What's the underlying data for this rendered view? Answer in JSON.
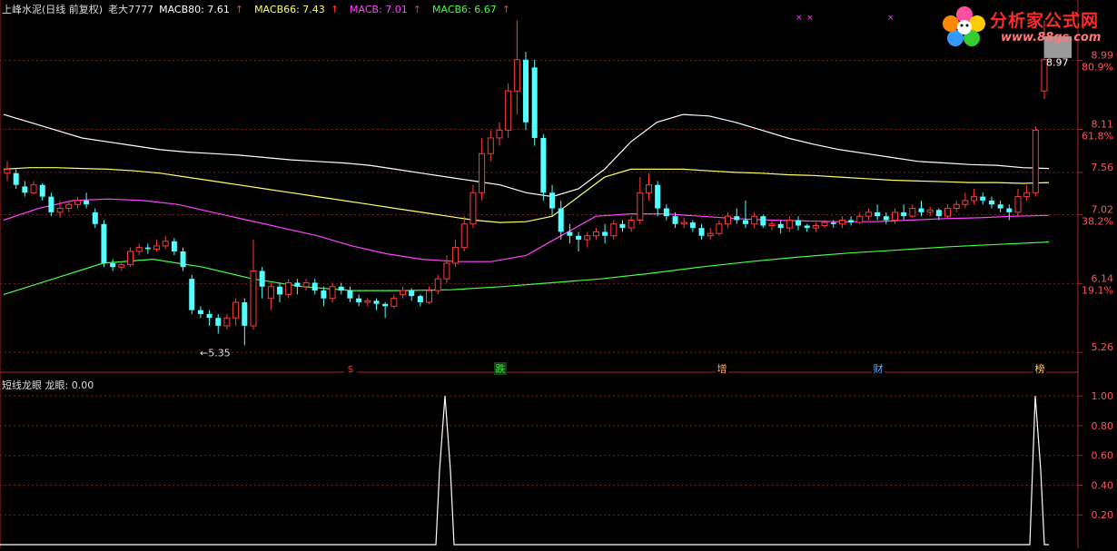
{
  "header": {
    "stock": "上峰水泥(日线 前复权)",
    "author": "老大7777",
    "indicators": [
      {
        "label": "MACB80: 7.61",
        "color": "#ffffff",
        "arrow": "↑"
      },
      {
        "label": "MACB66: 7.43",
        "color": "#ffff66",
        "arrow": "↑"
      },
      {
        "label": "MACB: 7.01",
        "color": "#ff44ff",
        "arrow": "↑"
      },
      {
        "label": "MACB6: 6.67",
        "color": "#44ff44",
        "arrow": "↑"
      }
    ]
  },
  "sub_header": {
    "title": "短线龙眼",
    "value_label": "龙眼: 0.00"
  },
  "watermark": {
    "title": "分析家公式网",
    "url": "www.88gs.com"
  },
  "price_axis": {
    "labels": [
      {
        "value": 8.99,
        "pct": "80.9%"
      },
      {
        "value": 8.11,
        "pct": "61.8%"
      },
      {
        "value": 7.56,
        "pct": ""
      },
      {
        "value": 7.02,
        "pct": "38.2%"
      },
      {
        "value": 6.14,
        "pct": "19.1%"
      },
      {
        "value": 5.26,
        "pct": ""
      }
    ],
    "current_price": "8.97",
    "low_marker": "←5.35"
  },
  "event_markers": [
    {
      "label": "$",
      "color": "#ff3333"
    },
    {
      "label": "跌",
      "color": "#44dd44"
    },
    {
      "label": "增",
      "color": "#ffaa66"
    },
    {
      "label": "财",
      "color": "#66aaff"
    },
    {
      "label": "榜",
      "color": "#ffcc44"
    }
  ],
  "sub_axis": {
    "labels": [
      "1.00",
      "0.80",
      "0.60",
      "0.40",
      "0.20"
    ]
  },
  "chart_data": [
    {
      "type": "candlestick",
      "title": "上峰水泥(日线 前复权)",
      "y_range": [
        5.1,
        9.6
      ],
      "series": [
        {
          "name": "MACB80",
          "color": "#ffffff",
          "values": [
            8.3,
            8.2,
            8.1,
            8.0,
            7.95,
            7.9,
            7.85,
            7.82,
            7.8,
            7.78,
            7.75,
            7.72,
            7.7,
            7.68,
            7.65,
            7.6,
            7.55,
            7.5,
            7.45,
            7.4,
            7.3,
            7.25,
            7.35,
            7.6,
            7.95,
            8.2,
            8.3,
            8.28,
            8.2,
            8.1,
            8.0,
            7.92,
            7.85,
            7.8,
            7.75,
            7.7,
            7.68,
            7.66,
            7.65,
            7.62,
            7.61
          ]
        },
        {
          "name": "MACB66",
          "color": "#ffff66",
          "values": [
            7.6,
            7.62,
            7.62,
            7.61,
            7.6,
            7.58,
            7.55,
            7.5,
            7.45,
            7.4,
            7.35,
            7.3,
            7.25,
            7.2,
            7.15,
            7.1,
            7.05,
            7.0,
            6.95,
            6.92,
            6.93,
            7.0,
            7.25,
            7.5,
            7.6,
            7.6,
            7.6,
            7.58,
            7.56,
            7.55,
            7.53,
            7.52,
            7.5,
            7.48,
            7.46,
            7.45,
            7.44,
            7.43,
            7.43,
            7.42,
            7.43
          ]
        },
        {
          "name": "MACB",
          "color": "#ff44ff",
          "values": [
            6.95,
            7.1,
            7.2,
            7.22,
            7.2,
            7.15,
            7.05,
            6.95,
            6.85,
            6.75,
            6.62,
            6.52,
            6.45,
            6.42,
            6.42,
            6.5,
            6.75,
            7.0,
            7.03,
            7.03,
            7.0,
            6.97,
            6.95,
            6.94,
            6.93,
            6.93,
            6.95,
            6.97,
            6.98,
            7.0,
            7.01
          ]
        },
        {
          "name": "MACB6",
          "color": "#44ff44",
          "values": [
            6.0,
            6.2,
            6.4,
            6.45,
            6.35,
            6.2,
            6.1,
            6.05,
            6.05,
            6.06,
            6.1,
            6.15,
            6.2,
            6.27,
            6.35,
            6.42,
            6.48,
            6.53,
            6.57,
            6.61,
            6.64,
            6.67
          ]
        }
      ],
      "candles": [
        [
          7.55,
          7.6,
          7.45,
          7.7
        ],
        [
          7.55,
          7.4,
          7.35,
          7.6
        ],
        [
          7.38,
          7.3,
          7.25,
          7.45
        ],
        [
          7.3,
          7.4,
          7.28,
          7.45
        ],
        [
          7.4,
          7.25,
          7.2,
          7.42
        ],
        [
          7.25,
          7.05,
          7.0,
          7.3
        ],
        [
          7.05,
          7.1,
          6.98,
          7.2
        ],
        [
          7.1,
          7.15,
          7.05,
          7.2
        ],
        [
          7.15,
          7.2,
          7.1,
          7.25
        ],
        [
          7.2,
          7.15,
          7.1,
          7.3
        ],
        [
          7.05,
          6.9,
          6.85,
          7.1
        ],
        [
          6.9,
          6.4,
          6.35,
          6.95
        ],
        [
          6.4,
          6.35,
          6.3,
          6.45
        ],
        [
          6.35,
          6.38,
          6.3,
          6.42
        ],
        [
          6.38,
          6.55,
          6.35,
          6.6
        ],
        [
          6.55,
          6.6,
          6.5,
          6.65
        ],
        [
          6.6,
          6.58,
          6.52,
          6.65
        ],
        [
          6.58,
          6.62,
          6.55,
          6.7
        ],
        [
          6.62,
          6.68,
          6.58,
          6.75
        ],
        [
          6.68,
          6.55,
          6.5,
          6.72
        ],
        [
          6.55,
          6.35,
          6.3,
          6.6
        ],
        [
          6.2,
          5.8,
          5.75,
          6.25
        ],
        [
          5.8,
          5.75,
          5.7,
          5.85
        ],
        [
          5.75,
          5.7,
          5.6,
          5.8
        ],
        [
          5.7,
          5.6,
          5.5,
          5.75
        ],
        [
          5.6,
          5.7,
          5.55,
          5.75
        ],
        [
          5.7,
          5.9,
          5.6,
          5.95
        ],
        [
          5.9,
          5.6,
          5.35,
          5.95
        ],
        [
          5.6,
          6.3,
          5.55,
          6.7
        ],
        [
          6.3,
          6.1,
          5.95,
          6.35
        ],
        [
          5.95,
          6.1,
          5.8,
          6.15
        ],
        [
          6.1,
          6.0,
          5.9,
          6.15
        ],
        [
          6.0,
          6.15,
          5.95,
          6.2
        ],
        [
          6.15,
          6.1,
          6.0,
          6.2
        ],
        [
          6.1,
          6.15,
          6.05,
          6.2
        ],
        [
          6.15,
          6.05,
          6.0,
          6.2
        ],
        [
          6.05,
          5.95,
          5.85,
          6.1
        ],
        [
          5.95,
          6.1,
          5.9,
          6.15
        ],
        [
          6.1,
          6.05,
          6.0,
          6.15
        ],
        [
          6.05,
          5.95,
          5.9,
          6.1
        ],
        [
          5.95,
          5.9,
          5.85,
          6.0
        ],
        [
          5.9,
          5.92,
          5.85,
          5.95
        ],
        [
          5.92,
          5.88,
          5.8,
          5.95
        ],
        [
          5.88,
          5.85,
          5.7,
          5.9
        ],
        [
          5.85,
          5.95,
          5.82,
          6.0
        ],
        [
          6.0,
          6.05,
          5.95,
          6.1
        ],
        [
          6.05,
          5.98,
          5.92,
          6.08
        ],
        [
          5.98,
          5.9,
          5.85,
          6.0
        ],
        [
          5.9,
          6.05,
          5.88,
          6.1
        ],
        [
          6.05,
          6.2,
          6.0,
          6.25
        ],
        [
          6.2,
          6.4,
          6.15,
          6.5
        ],
        [
          6.4,
          6.6,
          6.35,
          6.7
        ],
        [
          6.6,
          6.9,
          6.55,
          7.0
        ],
        [
          6.9,
          7.3,
          6.85,
          7.4
        ],
        [
          7.3,
          7.8,
          7.2,
          8.0
        ],
        [
          7.8,
          8.0,
          7.7,
          8.1
        ],
        [
          8.0,
          8.1,
          7.9,
          8.2
        ],
        [
          8.1,
          8.6,
          8.0,
          8.7
        ],
        [
          8.6,
          9.0,
          8.3,
          9.5
        ],
        [
          9.0,
          8.2,
          8.1,
          9.1
        ],
        [
          8.9,
          8.0,
          7.9,
          9.0
        ],
        [
          8.0,
          7.3,
          7.2,
          8.05
        ],
        [
          7.3,
          7.1,
          7.0,
          7.4
        ],
        [
          7.1,
          6.8,
          6.7,
          7.2
        ],
        [
          6.8,
          6.75,
          6.65,
          6.9
        ],
        [
          6.75,
          6.7,
          6.55,
          6.8
        ],
        [
          6.7,
          6.75,
          6.6,
          6.8
        ],
        [
          6.75,
          6.8,
          6.7,
          6.85
        ],
        [
          6.8,
          6.75,
          6.65,
          6.9
        ],
        [
          6.75,
          6.9,
          6.7,
          6.95
        ],
        [
          6.9,
          6.85,
          6.8,
          6.95
        ],
        [
          6.85,
          6.95,
          6.8,
          7.0
        ],
        [
          6.95,
          7.3,
          6.9,
          7.5
        ],
        [
          7.3,
          7.4,
          7.2,
          7.55
        ],
        [
          7.4,
          7.1,
          7.0,
          7.45
        ],
        [
          7.1,
          7.0,
          6.95,
          7.15
        ],
        [
          7.0,
          6.9,
          6.85,
          7.05
        ],
        [
          6.9,
          6.92,
          6.85,
          6.98
        ],
        [
          6.92,
          6.85,
          6.8,
          6.95
        ],
        [
          6.85,
          6.75,
          6.7,
          6.9
        ],
        [
          6.75,
          6.78,
          6.7,
          6.85
        ],
        [
          6.78,
          6.9,
          6.75,
          6.95
        ],
        [
          6.9,
          7.0,
          6.85,
          7.05
        ],
        [
          7.0,
          6.95,
          6.9,
          7.1
        ],
        [
          6.95,
          6.9,
          6.85,
          7.2
        ],
        [
          6.9,
          7.0,
          6.85,
          7.05
        ],
        [
          7.0,
          6.88,
          6.85,
          7.02
        ],
        [
          6.88,
          6.9,
          6.82,
          6.95
        ],
        [
          6.9,
          6.85,
          6.78,
          6.95
        ],
        [
          6.85,
          6.95,
          6.8,
          7.0
        ],
        [
          6.95,
          6.88,
          6.82,
          7.0
        ],
        [
          6.88,
          6.85,
          6.8,
          6.9
        ],
        [
          6.85,
          6.88,
          6.8,
          6.92
        ],
        [
          6.88,
          6.92,
          6.85,
          6.95
        ],
        [
          6.92,
          6.9,
          6.85,
          6.95
        ],
        [
          6.9,
          6.95,
          6.85,
          7.0
        ],
        [
          6.95,
          6.92,
          6.88,
          7.0
        ],
        [
          6.92,
          7.0,
          6.9,
          7.05
        ],
        [
          7.0,
          7.05,
          6.95,
          7.1
        ],
        [
          7.05,
          7.0,
          6.95,
          7.15
        ],
        [
          7.0,
          6.95,
          6.9,
          7.05
        ],
        [
          6.95,
          7.05,
          6.9,
          7.1
        ],
        [
          7.05,
          7.0,
          6.95,
          7.15
        ],
        [
          7.0,
          7.1,
          6.98,
          7.15
        ],
        [
          7.1,
          7.05,
          7.0,
          7.2
        ],
        [
          7.05,
          7.08,
          7.0,
          7.12
        ],
        [
          7.08,
          7.0,
          6.95,
          7.1
        ],
        [
          7.0,
          7.1,
          6.98,
          7.15
        ],
        [
          7.1,
          7.15,
          7.05,
          7.2
        ],
        [
          7.15,
          7.2,
          7.1,
          7.3
        ],
        [
          7.2,
          7.25,
          7.15,
          7.35
        ],
        [
          7.25,
          7.2,
          7.15,
          7.3
        ],
        [
          7.2,
          7.15,
          7.1,
          7.25
        ],
        [
          7.15,
          7.1,
          7.05,
          7.2
        ],
        [
          7.1,
          7.05,
          6.95,
          7.15
        ],
        [
          7.05,
          7.25,
          7.0,
          7.35
        ],
        [
          7.25,
          7.3,
          7.2,
          7.4
        ],
        [
          7.3,
          8.1,
          7.25,
          8.15
        ],
        [
          8.6,
          9.0,
          8.5,
          9.5
        ]
      ]
    },
    {
      "type": "line",
      "title": "短线龙眼",
      "y_range": [
        0,
        1.05
      ],
      "series": [
        {
          "name": "龙眼",
          "color": "#ffffff",
          "x": [
            0,
            480,
            484,
            490,
            496,
            500,
            1130,
            1134,
            1140,
            1146,
            1150,
            1155
          ],
          "values": [
            0,
            0,
            0.5,
            1.0,
            0.5,
            0,
            0,
            0,
            1.0,
            0.5,
            0,
            0
          ]
        }
      ]
    }
  ]
}
